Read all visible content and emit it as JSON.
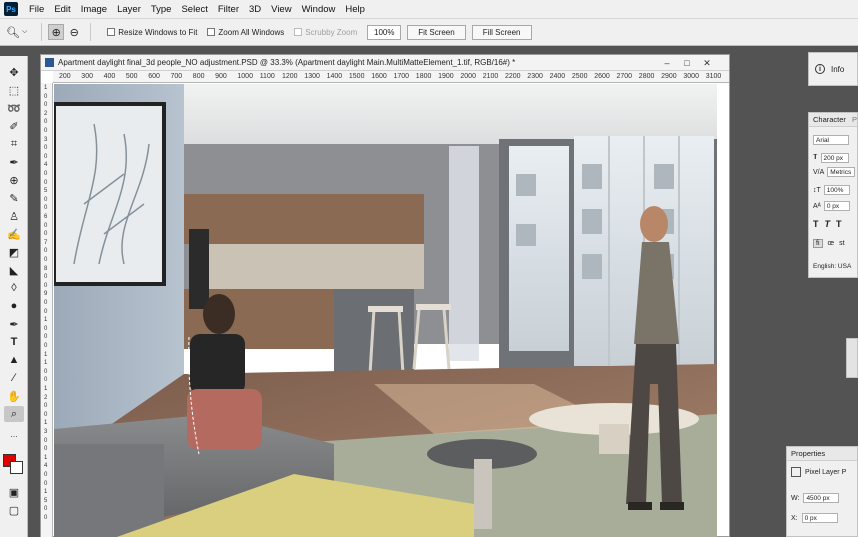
{
  "app": {
    "logo": "Ps"
  },
  "menu": [
    "File",
    "Edit",
    "Image",
    "Layer",
    "Type",
    "Select",
    "Filter",
    "3D",
    "View",
    "Window",
    "Help"
  ],
  "options": {
    "tool_icon": "zoom-icon",
    "resize_windows": "Resize Windows to Fit",
    "zoom_all": "Zoom All Windows",
    "scrubby_zoom": "Scrubby Zoom",
    "zoom_value": "100%",
    "fit_screen": "Fit Screen",
    "fill_screen": "Fill Screen"
  },
  "document": {
    "title": "Apartment daylight final_3d people_NO adjustment.PSD @ 33.3% (Apartment daylight Main.MultiMatteElement_1.tif, RGB/16#) *",
    "ruler_h": [
      "200",
      "300",
      "400",
      "500",
      "600",
      "700",
      "800",
      "900",
      "1000",
      "1100",
      "1200",
      "1300",
      "1400",
      "1500",
      "1600",
      "1700",
      "1800",
      "1900",
      "2000",
      "2100",
      "2200",
      "2300",
      "2400",
      "2500",
      "2600",
      "2700",
      "2800",
      "2900",
      "3000",
      "3100"
    ],
    "ruler_v": [
      "1",
      "0",
      "0",
      "2",
      "0",
      "0",
      "3",
      "0",
      "0",
      "4",
      "0",
      "0",
      "5",
      "0",
      "0",
      "6",
      "0",
      "0",
      "7",
      "0",
      "0",
      "8",
      "0",
      "0",
      "9",
      "0",
      "0",
      "1",
      "0",
      "0",
      "0",
      "1",
      "1",
      "0",
      "0",
      "1",
      "2",
      "0",
      "0",
      "1",
      "3",
      "0",
      "0",
      "1",
      "4",
      "0",
      "0",
      "1",
      "5",
      "0",
      "0"
    ]
  },
  "colors": {
    "foreground": "#e10000",
    "background": "#ffffff"
  },
  "panels": {
    "info": {
      "label": "Info"
    },
    "character": {
      "tab1": "Character",
      "tab2": "P",
      "font": "Arial",
      "size": "200 px",
      "kerning": "Metrics",
      "vscale": "100%",
      "baseline": "0 px",
      "language": "English: USA"
    },
    "properties": {
      "tab": "Properties",
      "layer_type": "Pixel Layer P",
      "w_label": "W:",
      "w_value": "4500 px",
      "x_label": "X:",
      "x_value": "0 px"
    }
  }
}
